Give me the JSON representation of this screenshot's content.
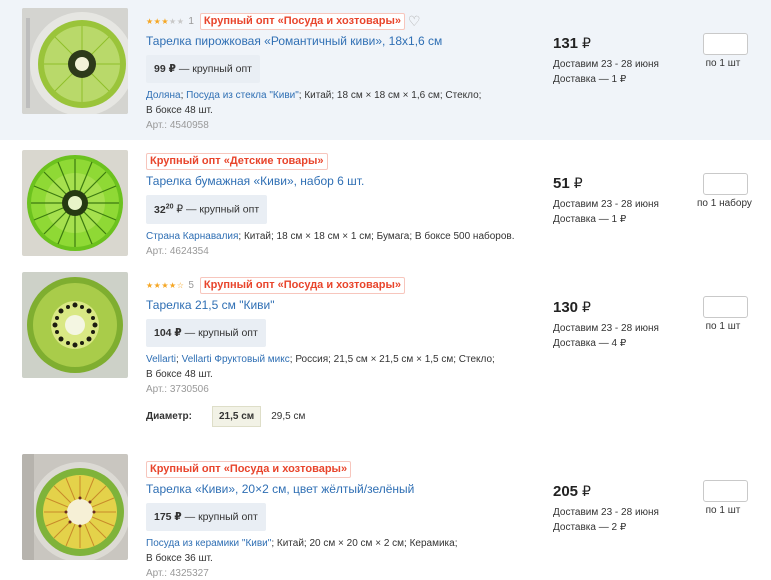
{
  "products": [
    {
      "rating_text": "1",
      "stars": 3,
      "badge": "Крупный опт «Посуда и хозтовары»",
      "title": "Тарелка пирожковая «Романтичный киви», 18х1,6 см",
      "wholesale_price": "99 ₽",
      "wholesale_label": " — крупный опт",
      "attr_links": [
        "Доляна",
        "Посуда из стекла \"Киви\""
      ],
      "attr_text": "; Китай; 18 см × 18 см × 1,6 см; Стекло;",
      "box": "В боксе 48 шт.",
      "sku": "Арт.: 4540958",
      "price": "131",
      "currency": "₽",
      "delivery_date": "Доставим 23 - 28 июня",
      "delivery_cost": "Доставка — 1 ₽",
      "unit": "по 1 шт"
    },
    {
      "badge": "Крупный опт «Детские товары»",
      "title": "Тарелка бумажная «Киви», набор 6 шт.",
      "wholesale_price_main": "32",
      "wholesale_price_frac": "20",
      "wholesale_price_cur": " ₽",
      "wholesale_label": " — крупный опт",
      "attr_links": [
        "Страна Карнавалия"
      ],
      "attr_text": "; Китай; 18 см × 18 см × 1 см; Бумага; В боксе 500 наборов.",
      "sku": "Арт.: 4624354",
      "price": "51",
      "currency": "₽",
      "delivery_date": "Доставим 23 - 28 июня",
      "delivery_cost": "Доставка — 1 ₽",
      "unit": "по 1 набору"
    },
    {
      "rating_text": "5",
      "stars": 4.5,
      "badge": "Крупный опт «Посуда и хозтовары»",
      "title": "Тарелка 21,5 см \"Киви\"",
      "wholesale_price": "104 ₽",
      "wholesale_label": " — крупный опт",
      "attr_links": [
        "Vellarti",
        "Vellarti Фруктовый микс"
      ],
      "attr_text": "; Россия; 21,5 см × 21,5 см × 1,5 см; Стекло;",
      "box": "В боксе 48 шт.",
      "sku": "Арт.: 3730506",
      "price": "130",
      "currency": "₽",
      "delivery_date": "Доставим 23 - 28 июня",
      "delivery_cost": "Доставка — 4 ₽",
      "unit": "по 1 шт",
      "diameter_label": "Диаметр:",
      "diameter_options": [
        "21,5 см",
        "29,5 см"
      ],
      "diameter_selected": "21,5 см"
    },
    {
      "badge": "Крупный опт «Посуда и хозтовары»",
      "title": "Тарелка «Киви», 20×2 см, цвет жёлтый/зелёный",
      "wholesale_price": "175 ₽",
      "wholesale_label": " — крупный опт",
      "attr_links": [
        "Посуда из керамики \"Киви\""
      ],
      "attr_text": "; Китай; 20 см × 20 см × 2 см; Керамика;",
      "box": "В боксе 36 шт.",
      "sku": "Арт.: 4325327",
      "price": "205",
      "currency": "₽",
      "delivery_date": "Доставим 23 - 28 июня",
      "delivery_cost": "Доставка — 2 ₽",
      "unit": "по 1 шт"
    }
  ],
  "icons": {
    "star": "star-icon",
    "heart": "heart-icon"
  },
  "colors": {
    "link": "#2f6fb4",
    "badge": "#e8452c",
    "star": "#f5a623",
    "highlight_row": "#f0f4f9"
  }
}
